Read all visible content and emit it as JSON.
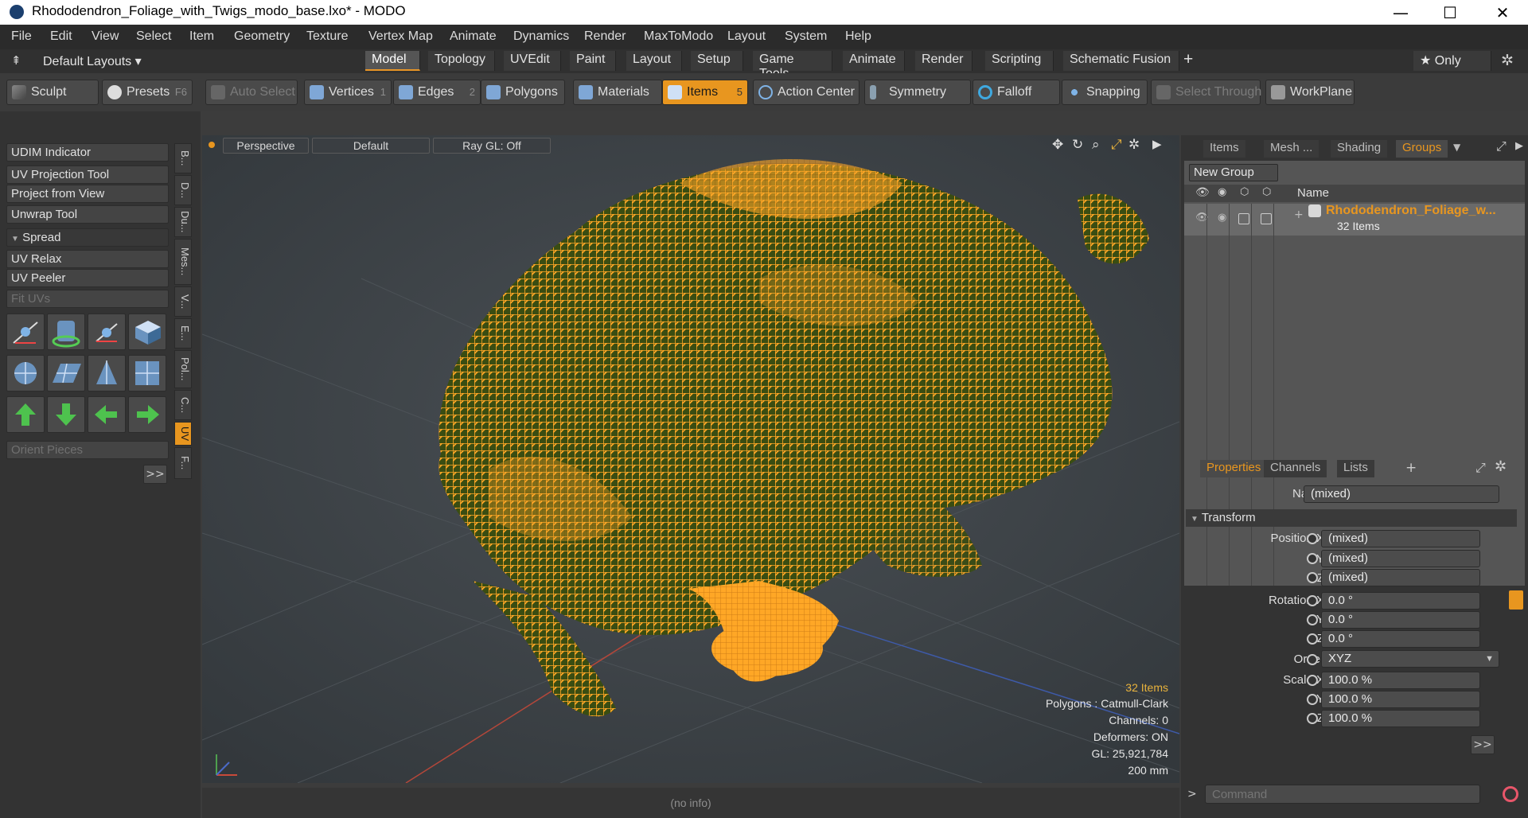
{
  "window": {
    "title": "Rhododendron_Foliage_with_Twigs_modo_base.lxo* - MODO",
    "minimize": "—",
    "maximize": "☐",
    "close": "✕"
  },
  "menu": [
    "File",
    "Edit",
    "View",
    "Select",
    "Item",
    "Geometry",
    "Texture",
    "Vertex Map",
    "Animate",
    "Dynamics",
    "Render",
    "MaxToModo",
    "Layout",
    "System",
    "Help"
  ],
  "layout_tabs": {
    "selector": "Default Layouts ▾",
    "tabs": [
      "Model",
      "Topology",
      "UVEdit",
      "Paint",
      "Layout",
      "Setup",
      "Game Tools",
      "Animate",
      "Render",
      "Scripting",
      "Schematic Fusion"
    ],
    "active": "Model",
    "add": "+",
    "only_label": "★  Only",
    "gear": "✲"
  },
  "toolbar": {
    "sculpt": "Sculpt",
    "presets": "Presets",
    "presets_key": "F6",
    "auto_select": "Auto Select",
    "vertices": "Vertices",
    "vertices_key": "1",
    "edges": "Edges",
    "edges_key": "2",
    "polygons": "Polygons",
    "materials": "Materials",
    "items": "Items",
    "items_key": "5",
    "action_center": "Action Center",
    "symmetry": "Symmetry",
    "falloff": "Falloff",
    "snapping": "Snapping",
    "select_through": "Select Through",
    "workplane": "WorkPlane"
  },
  "left_panel": {
    "buttons": [
      "UDIM Indicator",
      "UV Projection Tool",
      "Project from View",
      "Unwrap Tool",
      "Spread",
      "UV Relax",
      "UV Peeler",
      "Fit UVs"
    ],
    "spread_arrow": "▼",
    "orient": "Orient Pieces",
    "more": ">>",
    "vtabs": [
      "B...",
      "D...",
      "Du...",
      "Mes...",
      "V...",
      "E...",
      "Pol...",
      "C...",
      "UV",
      "F..."
    ]
  },
  "viewport": {
    "perspective": "Perspective",
    "shading": "Default",
    "raygl": "Ray GL: Off",
    "info": {
      "items": "32 Items",
      "polygons": "Polygons : Catmull-Clark",
      "channels": "Channels: 0",
      "deformers": "Deformers: ON",
      "gl": "GL: 25,921,784",
      "scale": "200 mm"
    },
    "status": "(no info)"
  },
  "items_panel": {
    "tabs": [
      "Items",
      "Mesh ...",
      "Shading",
      "Groups"
    ],
    "active": "Groups",
    "new_group": "New Group",
    "col_name": "Name",
    "group_name": "Rhododendron_Foliage_w...",
    "group_count": "32 Items"
  },
  "properties_panel": {
    "tabs": [
      "Properties",
      "Channels",
      "Lists"
    ],
    "active": "Properties",
    "add": "+",
    "name_label": "Name",
    "name_value": "(mixed)",
    "transform": "Transform",
    "position_label": "Position X",
    "rotation_label": "Rotation X",
    "order_label": "Order",
    "scale_label": "Scale X",
    "y_label": "Y",
    "z_label": "Z",
    "position": [
      "(mixed)",
      "(mixed)",
      "(mixed)"
    ],
    "rotation": [
      "0.0 °",
      "0.0 °",
      "0.0 °"
    ],
    "order": "XYZ",
    "scale": [
      "100.0 %",
      "100.0 %",
      "100.0 %"
    ],
    "more": ">>"
  },
  "command": {
    "prompt": ">",
    "placeholder": "Command"
  },
  "colors": {
    "accent": "#e8961f",
    "wire": "#ffa726",
    "foliage_dark": "#3a4d12"
  }
}
